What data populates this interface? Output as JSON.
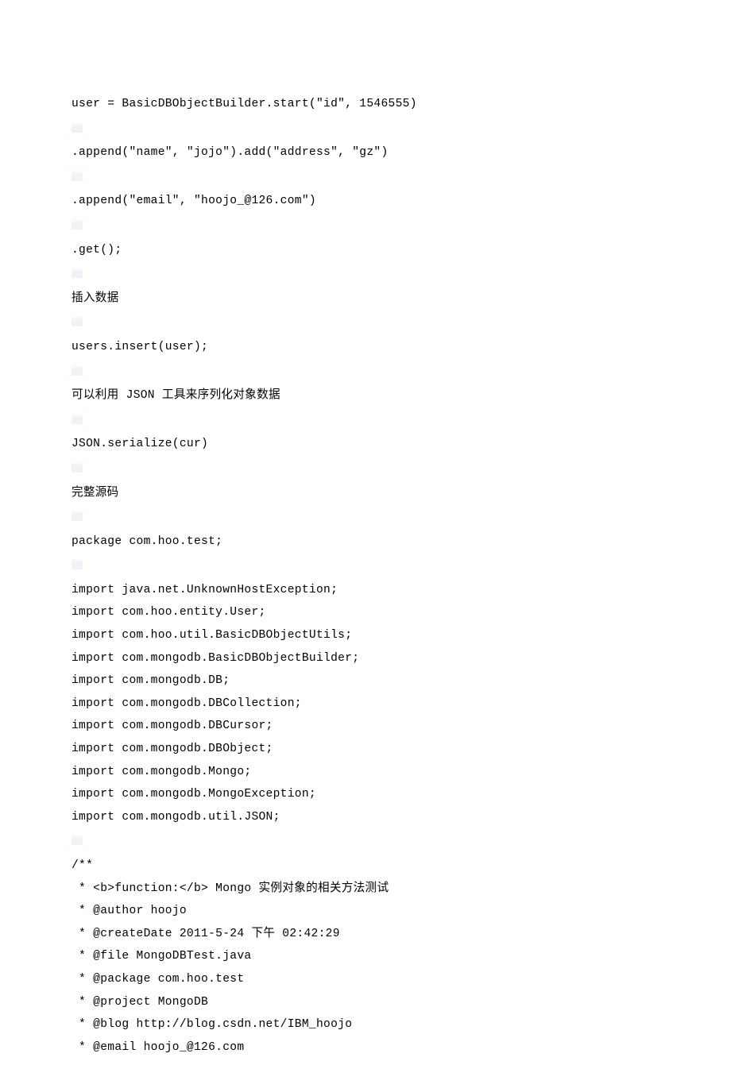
{
  "lines": {
    "l1": "user = BasicDBObjectBuilder.start(\"id\", 1546555)",
    "l2": ".append(\"name\", \"jojo\").add(\"address\", \"gz\")",
    "l3": ".append(\"email\", \"hoojo_@126.com\")",
    "l4": ".get();",
    "l5": "插入数据",
    "l6": "users.insert(user);",
    "l7": "可以利用 JSON 工具来序列化对象数据",
    "l8": "JSON.serialize(cur)",
    "l9": "完整源码",
    "l10": "package com.hoo.test;",
    "l11": "import java.net.UnknownHostException;",
    "l12": "import com.hoo.entity.User;",
    "l13": "import com.hoo.util.BasicDBObjectUtils;",
    "l14": "import com.mongodb.BasicDBObjectBuilder;",
    "l15": "import com.mongodb.DB;",
    "l16": "import com.mongodb.DBCollection;",
    "l17": "import com.mongodb.DBCursor;",
    "l18": "import com.mongodb.DBObject;",
    "l19": "import com.mongodb.Mongo;",
    "l20": "import com.mongodb.MongoException;",
    "l21": "import com.mongodb.util.JSON;",
    "l22": "/**",
    "l23": " * <b>function:</b> Mongo 实例对象的相关方法测试",
    "l24": " * @author hoojo",
    "l25": " * @createDate 2011-5-24 下午 02:42:29",
    "l26": " * @file MongoDBTest.java",
    "l27": " * @package com.hoo.test",
    "l28": " * @project MongoDB",
    "l29": " * @blog http://blog.csdn.net/IBM_hoojo",
    "l30": " * @email hoojo_@126.com"
  }
}
